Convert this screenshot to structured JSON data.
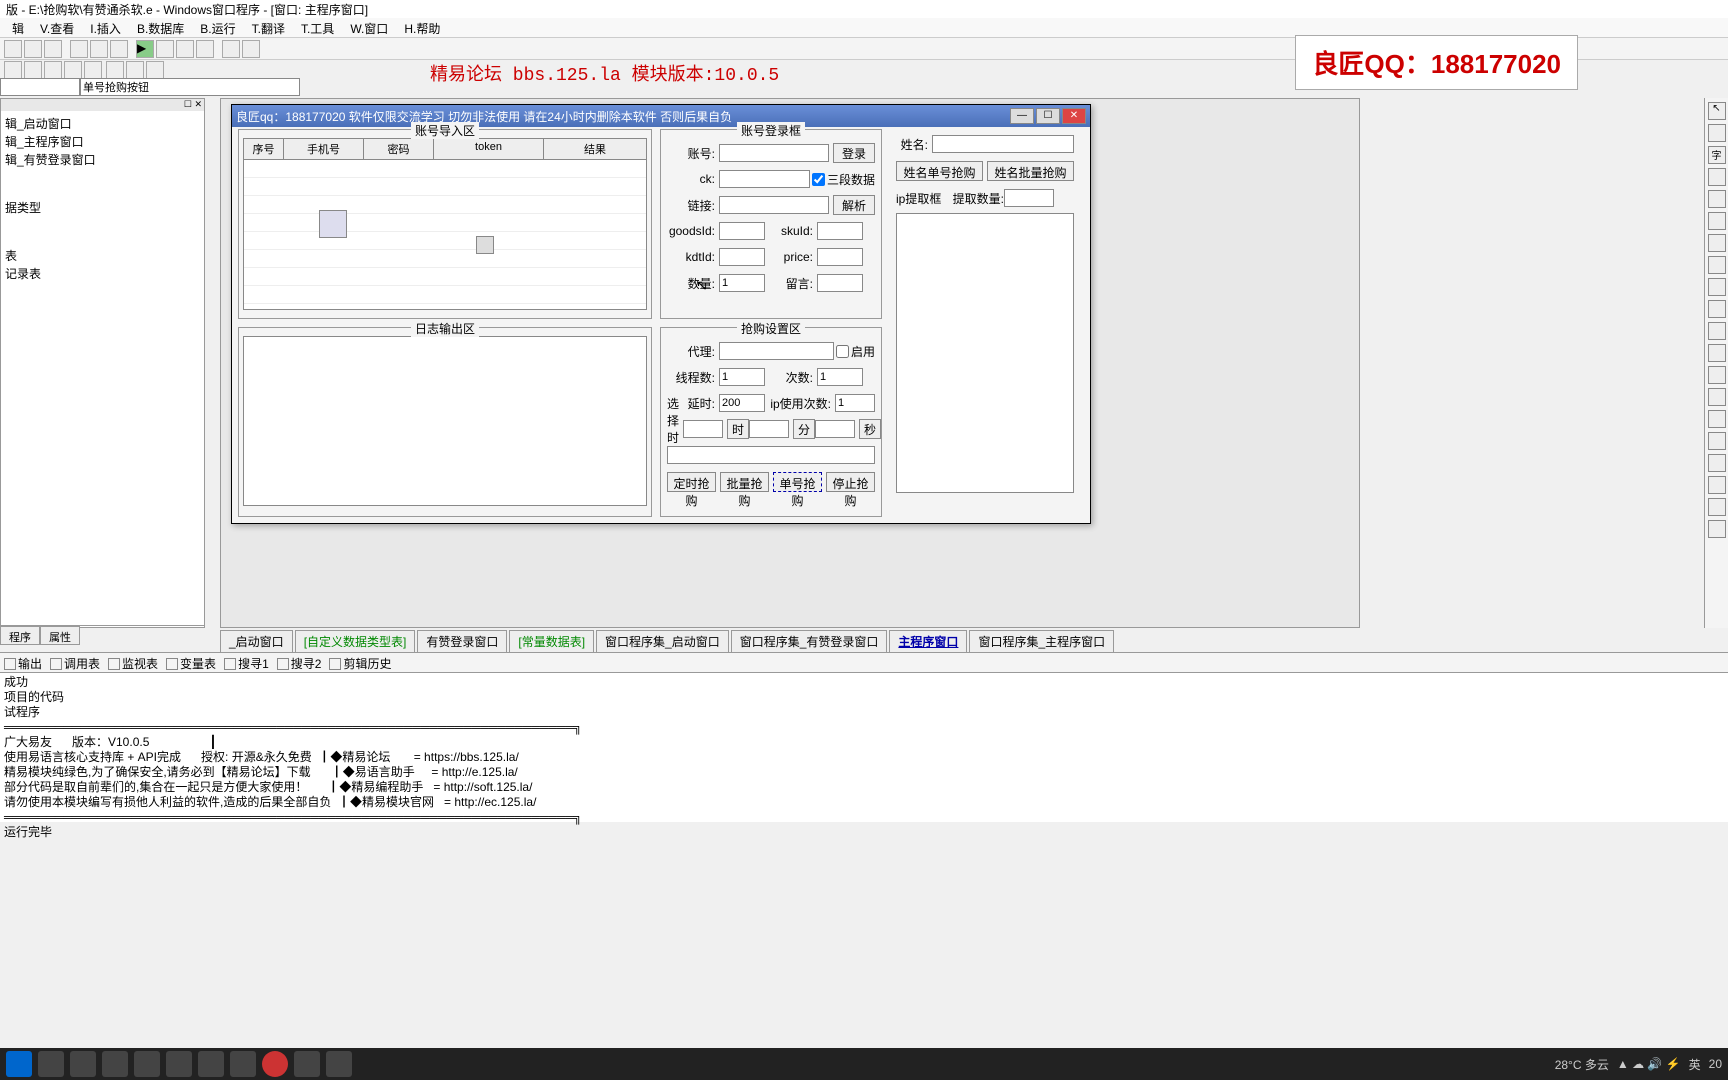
{
  "window_title": "版 - E:\\抢购软\\有赞通杀软.e - Windows窗口程序 - [窗口: 主程序窗口]",
  "menu": [
    "辑",
    "V.查看",
    "I.插入",
    "B.数据库",
    "B.运行",
    "T.翻译",
    "T.工具",
    "W.窗口",
    "H.帮助"
  ],
  "banner": "精易论坛 bbs.125.la 模块版本:10.0.5",
  "banner_qq": "良匠QQ：188177020",
  "combo": "单号抢购按钮",
  "tree": {
    "items": [
      "辑_启动窗口",
      "辑_主程序窗口",
      "辑_有赞登录窗口"
    ],
    "section2": "据类型",
    "section3": [
      "表",
      "记录表"
    ]
  },
  "left_tabs": [
    "程序",
    "属性"
  ],
  "form": {
    "title": "良匠qq：188177020 软件仅限交流学习 切勿非法使用 请在24小时内删除本软件 否则后果自负",
    "import": {
      "title": "账号导入区",
      "cols": [
        "序号",
        "手机号",
        "密码",
        "token",
        "结果"
      ]
    },
    "log_title": "日志输出区",
    "login": {
      "title": "账号登录框",
      "account": "账号:",
      "ck": "ck:",
      "link": "链接:",
      "goodsId": "goodsId:",
      "skuId": "skuId:",
      "kdtId": "kdtId:",
      "price": "price:",
      "qty": "数量:",
      "qty_val": "1",
      "msg": "留言:",
      "login_btn": "登录",
      "parse_btn": "解析",
      "three_seg": "三段数据"
    },
    "config": {
      "title": "抢购设置区",
      "proxy": "代理:",
      "enable": "启用",
      "threads": "线程数:",
      "threads_val": "1",
      "times": "次数:",
      "times_val": "1",
      "delay": "延时:",
      "delay_val": "200",
      "ip_times": "ip使用次数:",
      "ip_times_val": "1",
      "select_time": "选择时间",
      "hour": "时",
      "min": "分",
      "sec": "秒",
      "btn_timed": "定时抢购",
      "btn_batch": "批量抢购",
      "btn_single": "单号抢购",
      "btn_stop": "停止抢购"
    },
    "right": {
      "name": "姓名:",
      "btn_name_single": "姓名单号抢购",
      "btn_name_batch": "姓名批量抢购",
      "ip_url": "ip提取框",
      "ip_count": "提取数量:"
    }
  },
  "editor_tabs": [
    "_启动窗口",
    "[自定义数据类型表]",
    "有赞登录窗口",
    "[常量数据表]",
    "窗口程序集_启动窗口",
    "窗口程序集_有赞登录窗口",
    "主程序窗口",
    "窗口程序集_主程序窗口"
  ],
  "debug_tabs": [
    "输出",
    "调用表",
    "监视表",
    "变量表",
    "搜寻1",
    "搜寻2",
    "剪辑历史"
  ],
  "console": {
    "l1": "成功",
    "l2": "项目的代码",
    "l3": "试程序",
    "sep": "═══════════════════════════════════════════════════════════════════╗",
    "r1a": "广大易友      版本：V10.0.5",
    "r2a": "使用易语言核心支持库 + API完成      授权: 开源&永久免费",
    "r2b": "┃◆精易论坛       = https://bbs.125.la/",
    "r3a": "精易模块纯绿色,为了确保安全,请务必到【精易论坛】下载",
    "r3b": "┃◆易语言助手     = http://e.125.la/",
    "r4a": "部分代码是取自前辈们的,集合在一起只是方便大家使用！",
    "r4b": "┃◆精易编程助手   = http://soft.125.la/",
    "r5a": "请勿使用本模块编写有损他人利益的软件,造成的后果全部自负",
    "r5b": "┃◆精易模块官网   = http://ec.125.la/",
    "l_done": "运行完毕"
  },
  "taskbar": {
    "weather": "28°C 多云",
    "ime": "英",
    "time": "20"
  }
}
